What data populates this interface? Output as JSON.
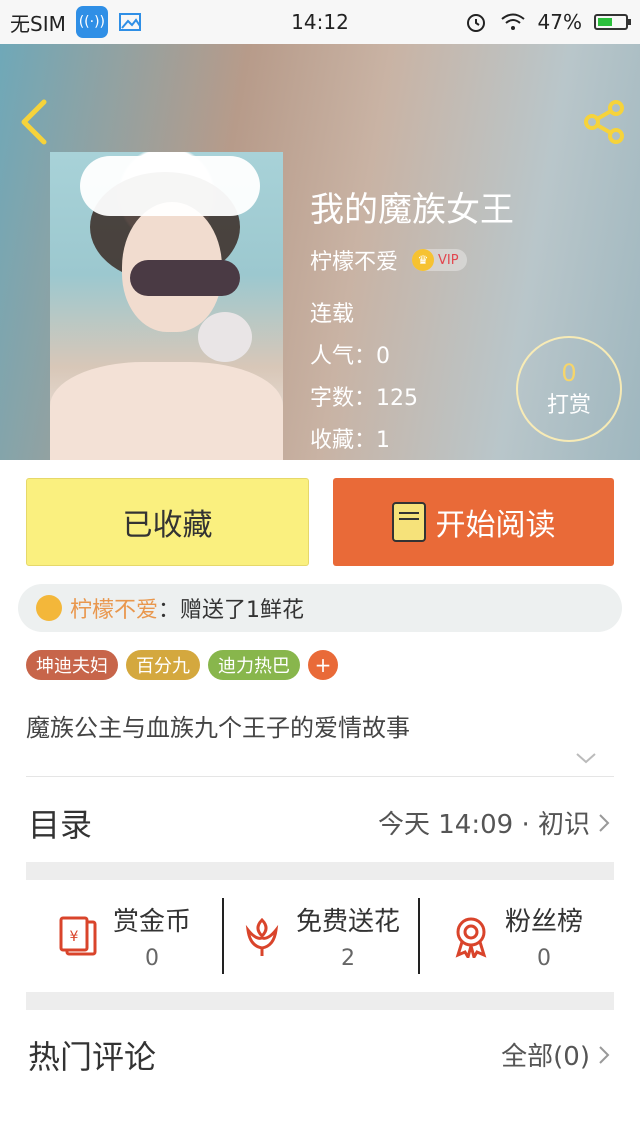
{
  "status_bar": {
    "carrier": "无SIM",
    "time": "14:12",
    "battery": "47%",
    "battery_level": 0.47
  },
  "header": {
    "book_title": "我的魔族女王",
    "author": "柠檬不爱",
    "vip_label": "VIP",
    "status": "连载",
    "popularity": "人气：0",
    "word_count": "字数：125",
    "favorites": "收藏：1",
    "reward_count": "0",
    "reward_label": "打赏"
  },
  "actions": {
    "collect_label": "已收藏",
    "read_label": "开始阅读"
  },
  "gift": {
    "user": "柠檬不爱",
    "text": "：赠送了1鲜花"
  },
  "tags": [
    "坤迪夫妇",
    "百分九",
    "迪力热巴"
  ],
  "tag_add": "+",
  "description": "魔族公主与血族九个王子的爱情故事",
  "catalog": {
    "title": "目录",
    "latest": "今天 14:09 · 初识"
  },
  "stats": [
    {
      "label": "赏金币",
      "value": "0",
      "icon": "red-envelope-icon"
    },
    {
      "label": "免费送花",
      "value": "2",
      "icon": "flower-icon"
    },
    {
      "label": "粉丝榜",
      "value": "0",
      "icon": "medal-icon"
    }
  ],
  "comments": {
    "title": "热门评论",
    "all": "全部(0)"
  },
  "colors": {
    "accent_orange": "#e96a38",
    "collect_yellow": "#faf07f",
    "icon_red": "#d9442b"
  }
}
